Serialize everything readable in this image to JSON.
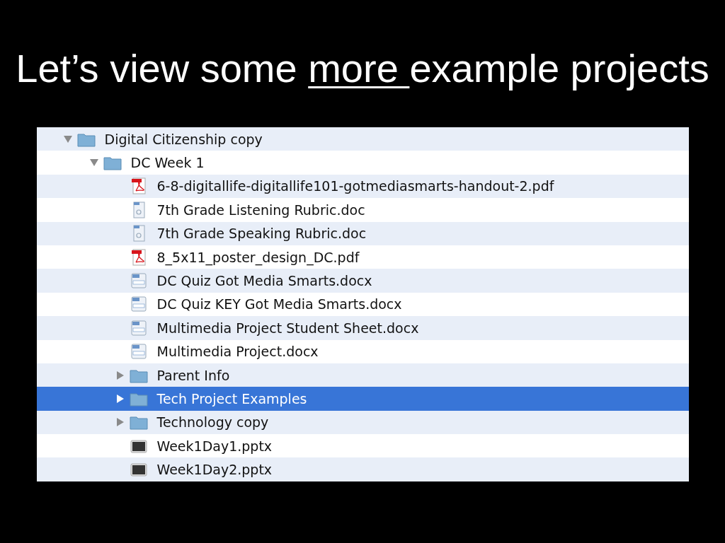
{
  "title": [
    {
      "text": "Let’s view some ",
      "underlined": false
    },
    {
      "text": "more ",
      "underlined": true
    },
    {
      "text": "example projects",
      "underlined": false
    }
  ],
  "tree": [
    {
      "name": "Digital Citizenship copy",
      "kind": "folder",
      "expanded": true,
      "selected": false,
      "children": [
        {
          "name": "DC Week 1",
          "kind": "folder",
          "expanded": true,
          "selected": false,
          "children": [
            {
              "name": "6-8-digitallife-digitallife101-gotmediasmarts-handout-2.pdf",
              "kind": "pdf",
              "selected": false
            },
            {
              "name": "7th Grade Listening Rubric.doc",
              "kind": "doc",
              "selected": false
            },
            {
              "name": "7th Grade Speaking Rubric.doc",
              "kind": "doc",
              "selected": false
            },
            {
              "name": "8_5x11_poster_design_DC.pdf",
              "kind": "pdf",
              "selected": false
            },
            {
              "name": "DC Quiz Got Media Smarts.docx",
              "kind": "docx",
              "selected": false
            },
            {
              "name": "DC Quiz KEY Got Media Smarts.docx",
              "kind": "docx",
              "selected": false
            },
            {
              "name": "Multimedia Project Student Sheet.docx",
              "kind": "docx",
              "selected": false
            },
            {
              "name": "Multimedia Project.docx",
              "kind": "docx",
              "selected": false
            },
            {
              "name": "Parent Info",
              "kind": "folder",
              "expanded": false,
              "selected": false
            },
            {
              "name": "Tech Project Examples",
              "kind": "folder",
              "expanded": false,
              "selected": true
            },
            {
              "name": "Technology copy",
              "kind": "folder",
              "expanded": false,
              "selected": false
            },
            {
              "name": "Week1Day1.pptx",
              "kind": "pptx",
              "selected": false
            },
            {
              "name": "Week1Day2.pptx",
              "kind": "pptx",
              "selected": false
            }
          ]
        }
      ]
    }
  ]
}
